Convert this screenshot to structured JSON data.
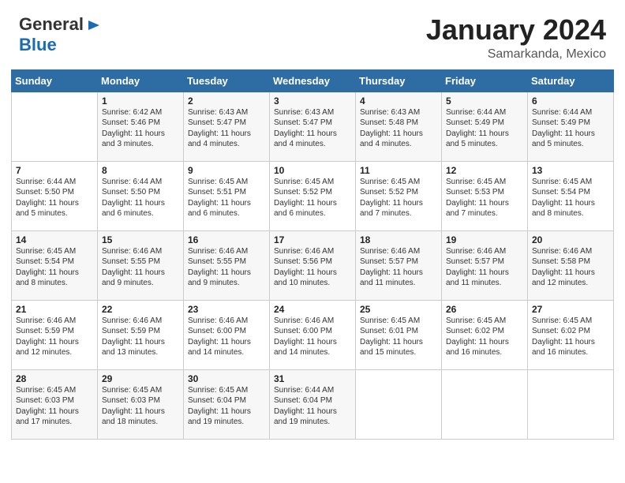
{
  "logo": {
    "general": "General",
    "blue": "Blue"
  },
  "title": {
    "month": "January 2024",
    "location": "Samarkanda, Mexico"
  },
  "header_days": [
    "Sunday",
    "Monday",
    "Tuesday",
    "Wednesday",
    "Thursday",
    "Friday",
    "Saturday"
  ],
  "weeks": [
    [
      {
        "num": "",
        "sunrise": "",
        "sunset": "",
        "daylight": ""
      },
      {
        "num": "1",
        "sunrise": "Sunrise: 6:42 AM",
        "sunset": "Sunset: 5:46 PM",
        "daylight": "Daylight: 11 hours and 3 minutes."
      },
      {
        "num": "2",
        "sunrise": "Sunrise: 6:43 AM",
        "sunset": "Sunset: 5:47 PM",
        "daylight": "Daylight: 11 hours and 4 minutes."
      },
      {
        "num": "3",
        "sunrise": "Sunrise: 6:43 AM",
        "sunset": "Sunset: 5:47 PM",
        "daylight": "Daylight: 11 hours and 4 minutes."
      },
      {
        "num": "4",
        "sunrise": "Sunrise: 6:43 AM",
        "sunset": "Sunset: 5:48 PM",
        "daylight": "Daylight: 11 hours and 4 minutes."
      },
      {
        "num": "5",
        "sunrise": "Sunrise: 6:44 AM",
        "sunset": "Sunset: 5:49 PM",
        "daylight": "Daylight: 11 hours and 5 minutes."
      },
      {
        "num": "6",
        "sunrise": "Sunrise: 6:44 AM",
        "sunset": "Sunset: 5:49 PM",
        "daylight": "Daylight: 11 hours and 5 minutes."
      }
    ],
    [
      {
        "num": "7",
        "sunrise": "Sunrise: 6:44 AM",
        "sunset": "Sunset: 5:50 PM",
        "daylight": "Daylight: 11 hours and 5 minutes."
      },
      {
        "num": "8",
        "sunrise": "Sunrise: 6:44 AM",
        "sunset": "Sunset: 5:50 PM",
        "daylight": "Daylight: 11 hours and 6 minutes."
      },
      {
        "num": "9",
        "sunrise": "Sunrise: 6:45 AM",
        "sunset": "Sunset: 5:51 PM",
        "daylight": "Daylight: 11 hours and 6 minutes."
      },
      {
        "num": "10",
        "sunrise": "Sunrise: 6:45 AM",
        "sunset": "Sunset: 5:52 PM",
        "daylight": "Daylight: 11 hours and 6 minutes."
      },
      {
        "num": "11",
        "sunrise": "Sunrise: 6:45 AM",
        "sunset": "Sunset: 5:52 PM",
        "daylight": "Daylight: 11 hours and 7 minutes."
      },
      {
        "num": "12",
        "sunrise": "Sunrise: 6:45 AM",
        "sunset": "Sunset: 5:53 PM",
        "daylight": "Daylight: 11 hours and 7 minutes."
      },
      {
        "num": "13",
        "sunrise": "Sunrise: 6:45 AM",
        "sunset": "Sunset: 5:54 PM",
        "daylight": "Daylight: 11 hours and 8 minutes."
      }
    ],
    [
      {
        "num": "14",
        "sunrise": "Sunrise: 6:45 AM",
        "sunset": "Sunset: 5:54 PM",
        "daylight": "Daylight: 11 hours and 8 minutes."
      },
      {
        "num": "15",
        "sunrise": "Sunrise: 6:46 AM",
        "sunset": "Sunset: 5:55 PM",
        "daylight": "Daylight: 11 hours and 9 minutes."
      },
      {
        "num": "16",
        "sunrise": "Sunrise: 6:46 AM",
        "sunset": "Sunset: 5:55 PM",
        "daylight": "Daylight: 11 hours and 9 minutes."
      },
      {
        "num": "17",
        "sunrise": "Sunrise: 6:46 AM",
        "sunset": "Sunset: 5:56 PM",
        "daylight": "Daylight: 11 hours and 10 minutes."
      },
      {
        "num": "18",
        "sunrise": "Sunrise: 6:46 AM",
        "sunset": "Sunset: 5:57 PM",
        "daylight": "Daylight: 11 hours and 11 minutes."
      },
      {
        "num": "19",
        "sunrise": "Sunrise: 6:46 AM",
        "sunset": "Sunset: 5:57 PM",
        "daylight": "Daylight: 11 hours and 11 minutes."
      },
      {
        "num": "20",
        "sunrise": "Sunrise: 6:46 AM",
        "sunset": "Sunset: 5:58 PM",
        "daylight": "Daylight: 11 hours and 12 minutes."
      }
    ],
    [
      {
        "num": "21",
        "sunrise": "Sunrise: 6:46 AM",
        "sunset": "Sunset: 5:59 PM",
        "daylight": "Daylight: 11 hours and 12 minutes."
      },
      {
        "num": "22",
        "sunrise": "Sunrise: 6:46 AM",
        "sunset": "Sunset: 5:59 PM",
        "daylight": "Daylight: 11 hours and 13 minutes."
      },
      {
        "num": "23",
        "sunrise": "Sunrise: 6:46 AM",
        "sunset": "Sunset: 6:00 PM",
        "daylight": "Daylight: 11 hours and 14 minutes."
      },
      {
        "num": "24",
        "sunrise": "Sunrise: 6:46 AM",
        "sunset": "Sunset: 6:00 PM",
        "daylight": "Daylight: 11 hours and 14 minutes."
      },
      {
        "num": "25",
        "sunrise": "Sunrise: 6:45 AM",
        "sunset": "Sunset: 6:01 PM",
        "daylight": "Daylight: 11 hours and 15 minutes."
      },
      {
        "num": "26",
        "sunrise": "Sunrise: 6:45 AM",
        "sunset": "Sunset: 6:02 PM",
        "daylight": "Daylight: 11 hours and 16 minutes."
      },
      {
        "num": "27",
        "sunrise": "Sunrise: 6:45 AM",
        "sunset": "Sunset: 6:02 PM",
        "daylight": "Daylight: 11 hours and 16 minutes."
      }
    ],
    [
      {
        "num": "28",
        "sunrise": "Sunrise: 6:45 AM",
        "sunset": "Sunset: 6:03 PM",
        "daylight": "Daylight: 11 hours and 17 minutes."
      },
      {
        "num": "29",
        "sunrise": "Sunrise: 6:45 AM",
        "sunset": "Sunset: 6:03 PM",
        "daylight": "Daylight: 11 hours and 18 minutes."
      },
      {
        "num": "30",
        "sunrise": "Sunrise: 6:45 AM",
        "sunset": "Sunset: 6:04 PM",
        "daylight": "Daylight: 11 hours and 19 minutes."
      },
      {
        "num": "31",
        "sunrise": "Sunrise: 6:44 AM",
        "sunset": "Sunset: 6:04 PM",
        "daylight": "Daylight: 11 hours and 19 minutes."
      },
      {
        "num": "",
        "sunrise": "",
        "sunset": "",
        "daylight": ""
      },
      {
        "num": "",
        "sunrise": "",
        "sunset": "",
        "daylight": ""
      },
      {
        "num": "",
        "sunrise": "",
        "sunset": "",
        "daylight": ""
      }
    ]
  ]
}
